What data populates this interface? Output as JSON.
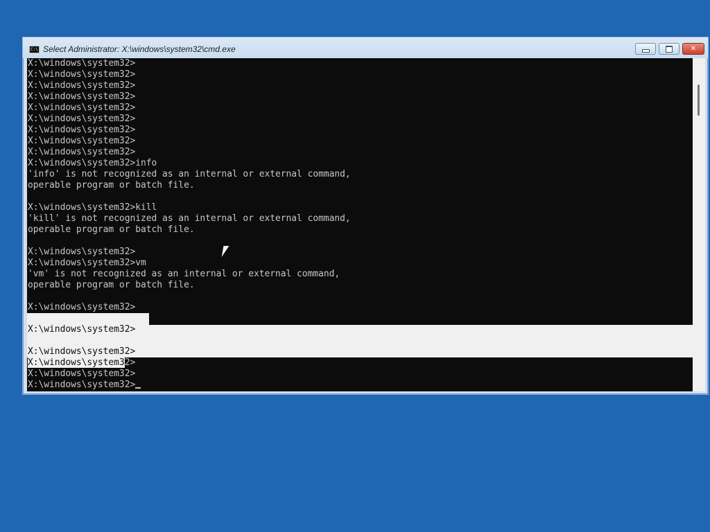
{
  "window": {
    "title": "Select Administrator: X:\\windows\\system32\\cmd.exe",
    "app_icon_label": "C:\\",
    "controls": {
      "minimize": "minimize-icon",
      "maximize": "maximize-icon",
      "close": "close-icon",
      "close_glyph": "✕"
    }
  },
  "console": {
    "prompt": "X:\\windows\\system32>",
    "lines": [
      "X:\\windows\\system32>",
      "X:\\windows\\system32>",
      "X:\\windows\\system32>",
      "X:\\windows\\system32>",
      "X:\\windows\\system32>",
      "X:\\windows\\system32>",
      "X:\\windows\\system32>",
      "X:\\windows\\system32>",
      "X:\\windows\\system32>",
      "X:\\windows\\system32>info",
      "'info' is not recognized as an internal or external command,",
      "operable program or batch file.",
      "",
      "X:\\windows\\system32>kill",
      "'kill' is not recognized as an internal or external command,",
      "operable program or batch file.",
      "",
      "X:\\windows\\system32>",
      "X:\\windows\\system32>vm",
      "'vm' is not recognized as an internal or external command,",
      "operable program or batch file.",
      "",
      "X:\\windows\\system32>",
      "",
      "X:\\windows\\system32>",
      "",
      "X:\\windows\\system32>",
      "X:\\windows\\system32>",
      "X:\\windows\\system32>",
      "X:\\windows\\system32>"
    ],
    "selection_partial_prefix": "X:\\windows\\system3",
    "selection_partial_suffix": "2>"
  },
  "colors": {
    "desktop": "#1f66b3",
    "console_background": "#0c0c0c",
    "console_text": "#c8c8c8",
    "selection": "#f0f0f0"
  }
}
